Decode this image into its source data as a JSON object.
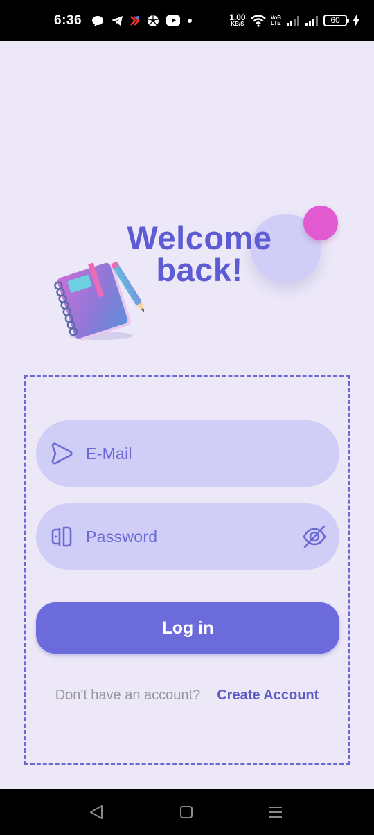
{
  "status_bar": {
    "time": "6:36",
    "net_speed_value": "1.00",
    "net_speed_unit": "KB/S",
    "volte_top": "VoB",
    "volte_bottom": "LTE",
    "battery": "60",
    "icons": [
      "chat-bubble-icon",
      "telegram-icon",
      "app-notification-icon",
      "football-icon",
      "youtube-icon",
      "dot-icon",
      "wifi-icon",
      "signal-icon",
      "signal-icon",
      "battery-icon",
      "charging-icon"
    ]
  },
  "hero": {
    "title_line1": "Welcome",
    "title_line2": "back!",
    "illustration": "notebook-pencil"
  },
  "form": {
    "email_placeholder": "E-Mail",
    "password_placeholder": "Password",
    "login_label": "Log in",
    "no_account_text": "Don't have an account?",
    "create_account_label": "Create Account"
  },
  "nav": {
    "items": [
      "back-icon",
      "home-icon",
      "recents-icon"
    ]
  },
  "colors": {
    "background": "#ECE8F8",
    "accent": "#6B69D4",
    "field": "#D0CEF6",
    "pink": "#E25AD0",
    "muted_text": "#97949F"
  }
}
